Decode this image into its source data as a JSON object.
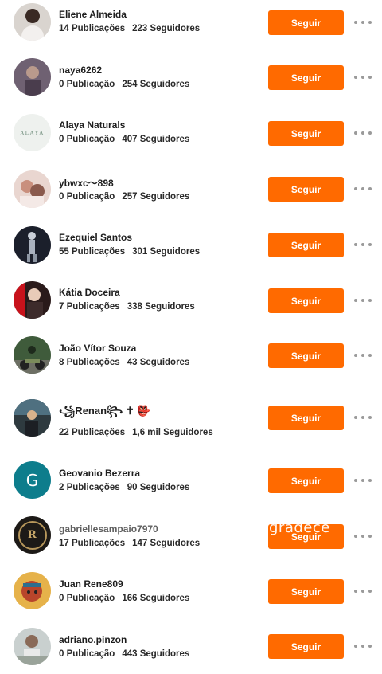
{
  "colors": {
    "accent": "#ff6a00",
    "dots": "#9a9a9a"
  },
  "follow_label": "Seguir",
  "users": [
    {
      "name": "Eliene Almeida",
      "posts": "14 Publicações",
      "followers": "223 Seguidores"
    },
    {
      "name": "naya6262",
      "posts": "0 Publicação",
      "followers": "254 Seguidores"
    },
    {
      "name": "Alaya Naturals",
      "posts": "0 Publicação",
      "followers": "407 Seguidores"
    },
    {
      "name": "ybwxc～898",
      "posts": "0 Publicação",
      "followers": "257 Seguidores"
    },
    {
      "name": "Ezequiel Santos",
      "posts": "55 Publicações",
      "followers": "301 Seguidores"
    },
    {
      "name": "Kátia Doceira",
      "posts": "7 Publicações",
      "followers": "338 Seguidores"
    },
    {
      "name": "João Vítor Souza",
      "posts": "8 Publicações",
      "followers": "43 Seguidores"
    },
    {
      "name": "꧁Renan꧂ ✝ 👺",
      "posts": "22 Publicações",
      "followers": "1,6 mil Seguidores"
    },
    {
      "name": "Geovanio Bezerra",
      "posts": "2 Publicações",
      "followers": "90 Seguidores"
    },
    {
      "name": "gabriellesampaio7970",
      "posts": "17 Publicações",
      "followers": "147 Seguidores"
    },
    {
      "name": "Juan Rene809",
      "posts": "0 Publicação",
      "followers": "166 Seguidores"
    },
    {
      "name": "adriano.pinzon",
      "posts": "0 Publicação",
      "followers": "443 Seguidores"
    }
  ],
  "avatar_letters": {
    "geovanio": "G",
    "alaya": "ALAYA",
    "gabrielle": "R"
  },
  "overlay_text": "gradece"
}
